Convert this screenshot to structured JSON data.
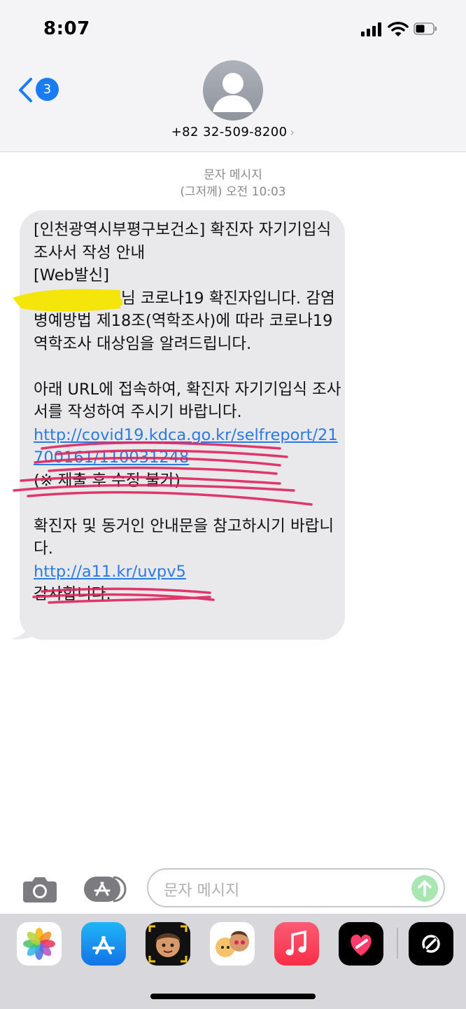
{
  "status": {
    "time": "8:07"
  },
  "nav": {
    "back_badge": "3",
    "contact": "+82 32-509-8200",
    "chevron": "›"
  },
  "thread": {
    "type": "문자 메시지",
    "timestamp": "(그저께) 오전 10:03"
  },
  "message": {
    "title": "[인천광역시부평구보건소] 확진자 자기기입식 조사서 작성 안내",
    "tag": "[Web발신]",
    "body1": "님 코로나19 확진자입니다. 감염병예방법 제18조(역학조사)에 따라 코로나19 역학조사 대상임을 알려드립니다.",
    "body2": "아래 URL에 접속하여, 확진자 자기기입식 조사서를 작성하여 주시기 바랍니다.",
    "link1": "http://covid19.kdca.go.kr/selfreport/21700161/110031248",
    "note": "(※ 제출 후 수정 불가)",
    "body3": "확진자 및 동거인 안내문을 참고하시기 바랍니다.",
    "link2": "http://a11.kr/uvpv5",
    "closing": "감사합니다."
  },
  "composer": {
    "placeholder": "문자 메시지"
  },
  "drawer": {
    "apps": [
      "photos-icon",
      "app-store-icon",
      "memoji-icon",
      "animoji-icon",
      "music-icon",
      "digital-touch-icon",
      "more-apps-icon"
    ]
  },
  "colors": {
    "accent": "#1a7cf2",
    "bubble": "#e9e9eb",
    "redaction_pink": "#e0245e",
    "highlight_yellow": "#f5e600"
  }
}
